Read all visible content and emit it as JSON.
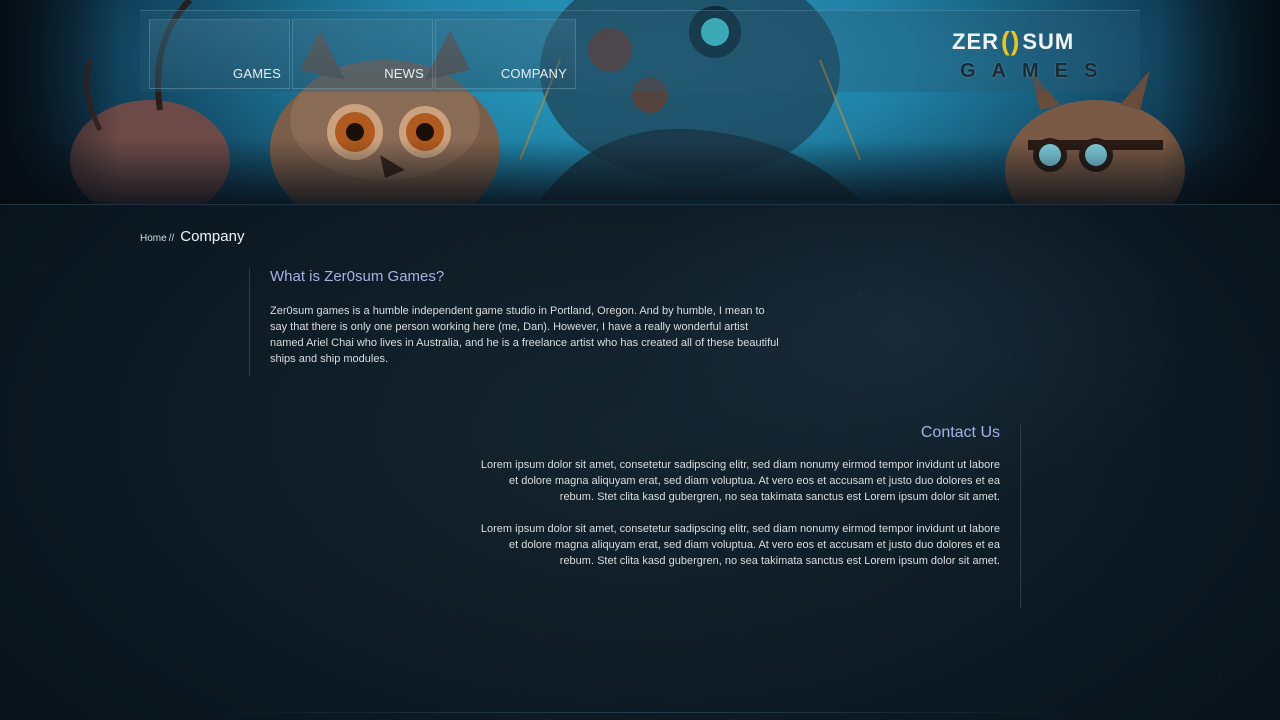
{
  "header": {
    "nav": [
      {
        "label": "GAMES"
      },
      {
        "label": "NEWS"
      },
      {
        "label": "COMPANY"
      }
    ],
    "logo": {
      "top_left": "ZER",
      "top_o": "()",
      "top_right": "SUM",
      "bottom": "GAMES"
    }
  },
  "breadcrumb": {
    "home": "Home",
    "separator": "//",
    "current": "Company"
  },
  "about": {
    "title": "What is Zer0sum Games?",
    "text": "Zer0sum games is a humble independent game studio in Portland, Oregon. And by humble, I mean to say that there is only one person working here (me, Dan). However, I have a really wonderful artist named Ariel Chai who lives in Australia, and he is a freelance artist who has created all of these beautiful ships and ship modules."
  },
  "contact": {
    "title": "Contact Us",
    "paragraphs": [
      "Lorem ipsum dolor sit amet, consetetur sadipscing elitr, sed diam nonumy eirmod tempor invidunt ut labore et dolore magna aliquyam erat, sed diam voluptua. At vero eos et accusam et justo duo dolores et ea rebum. Stet clita kasd gubergren, no sea takimata sanctus est Lorem ipsum dolor sit amet.",
      "Lorem ipsum dolor sit amet, consetetur sadipscing elitr, sed diam nonumy eirmod tempor invidunt ut labore et dolore magna aliquyam erat, sed diam voluptua. At vero eos et accusam et justo duo dolores et ea rebum. Stet clita kasd gubergren, no sea takimata sanctus est Lorem ipsum dolor sit amet."
    ]
  },
  "colors": {
    "accent_title": "#a6b2e6",
    "logo_yellow": "#f2c21b",
    "background": "#0c1822",
    "header_cyan": "#2aa3c7"
  },
  "icons": [
    "owl-creature-art",
    "goggles-creature-art",
    "robot-creature-art",
    "bug-creature-art"
  ]
}
